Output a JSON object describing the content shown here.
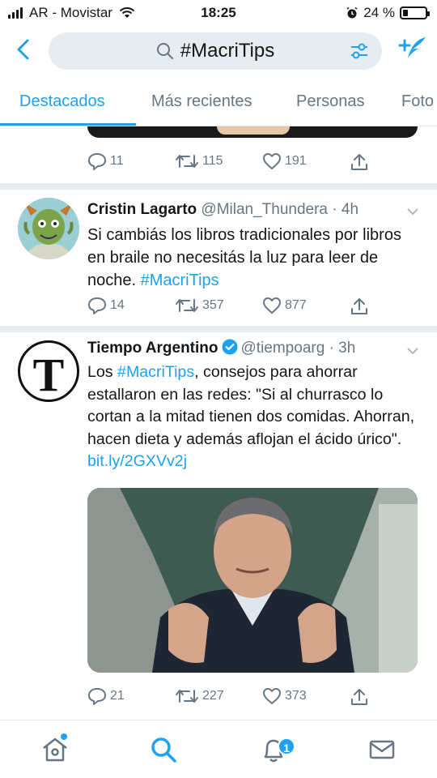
{
  "status_bar": {
    "carrier": "AR - Movistar",
    "time": "18:25",
    "battery_percent": "24 %",
    "battery_level": 0.24
  },
  "search": {
    "query": "#MacriTips",
    "icons": [
      "back-arrow-icon",
      "search-icon",
      "filter-icon",
      "compose-tweet-icon"
    ]
  },
  "tabs": [
    {
      "label": "Destacados",
      "active": true
    },
    {
      "label": "Más recientes",
      "active": false
    },
    {
      "label": "Personas",
      "active": false
    },
    {
      "label": "Foto",
      "active": false
    }
  ],
  "tweets": [
    {
      "replies": "11",
      "retweets": "115",
      "likes": "191"
    },
    {
      "name": "Cristin Lagarto",
      "handle": "@Milan_Thundera",
      "time": "· 4h",
      "text_plain": "Si cambiás los libros tradicionales por libros en braile no necesitás la luz para leer de noche. ",
      "hashtag": "#MacriTips",
      "replies": "14",
      "retweets": "357",
      "likes": "877"
    },
    {
      "name": "Tiempo Argentino",
      "handle": "@tiempoarg",
      "time": "· 3h",
      "verified": true,
      "text_before": "Los ",
      "hashtag": "#MacriTips",
      "text_after": ", consejos para ahorrar estallaron en las redes: \"Si al churrasco lo cortan a la mitad tienen dos comidas. Ahorran, hacen dieta y además aflojan el ácido úrico\". ",
      "link": "bit.ly/2GXVv2j",
      "avatar_letter": "T",
      "replies": "21",
      "retweets": "227",
      "likes": "373"
    }
  ],
  "bottom_nav": {
    "notifications_badge": "1",
    "items": [
      "home-icon",
      "search-icon",
      "notifications-icon",
      "messages-icon"
    ]
  },
  "colors": {
    "accent": "#1da1f2",
    "text": "#14171a",
    "secondary": "#657786",
    "divider": "#e6ecf0"
  }
}
